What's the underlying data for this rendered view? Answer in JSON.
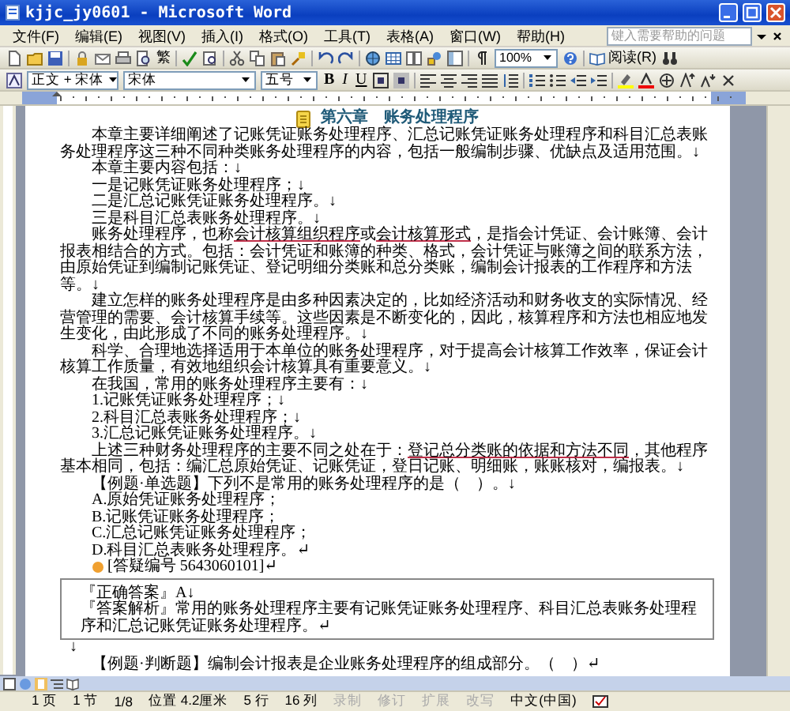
{
  "window": {
    "title": "kjjc_jy0601 - Microsoft Word"
  },
  "menu": {
    "items": [
      "文件(F)",
      "编辑(E)",
      "视图(V)",
      "插入(I)",
      "格式(O)",
      "工具(T)",
      "表格(A)",
      "窗口(W)",
      "帮助(H)"
    ],
    "help_placeholder": "键入需要帮助的问题"
  },
  "standard_toolbar": {
    "traditional_label": "繁",
    "zoom": "100%",
    "read_button": "阅读(R)"
  },
  "format_toolbar": {
    "style": "正文 + 宋体",
    "font": "宋体",
    "size": "五号",
    "buttons": [
      "B",
      "I",
      "U"
    ]
  },
  "document": {
    "blocks": [
      {
        "kind": "heading",
        "text": "第六章　账务处理程序"
      },
      {
        "kind": "paragraph",
        "text": "本章主要详细阐述了记账凭证账务处理程序、汇总记账凭证账务处理程序和科目汇总表账务处理程序这三种不同种类账务处理程序的内容，包括一般编制步骤、优缺点及适用范围。↓"
      },
      {
        "kind": "paragraph",
        "text": "本章主要内容包括：↓"
      },
      {
        "kind": "paragraph",
        "text": "一是记账凭证账务处理程序；↓"
      },
      {
        "kind": "paragraph",
        "text": "二是汇总记账凭证账务处理程序。↓"
      },
      {
        "kind": "paragraph",
        "text": "三是科目汇总表账务处理程序。↓"
      },
      {
        "kind": "paragraph",
        "segments": [
          {
            "text": "账务处理程序，也称",
            "link": false
          },
          {
            "text": "会计核算组织程序",
            "link": true
          },
          {
            "text": "或",
            "link": false
          },
          {
            "text": "会计核算形式",
            "link": true
          },
          {
            "text": "，是指会计凭证、会计账簿、会计报表相结合的方式。包括：会计凭证和账簿的种类、格式，会计凭证与账簿之间的联系方法，由原始凭证到编制记账凭证、登记明细分类账和总分类账，编制会计报表的工作程序和方法等。↓",
            "link": false
          }
        ]
      },
      {
        "kind": "paragraph",
        "text": "建立怎样的账务处理程序是由多种因素决定的，比如经济活动和财务收支的实际情况、经营管理的需要、会计核算手续等。这些因素是不断变化的，因此，核算程序和方法也相应地发生变化，由此形成了不同的账务处理程序。↓"
      },
      {
        "kind": "paragraph",
        "text": "科学、合理地选择适用于本单位的账务处理程序，对于提高会计核算工作效率，保证会计核算工作质量，有效地组织会计核算具有重要意义。↓"
      },
      {
        "kind": "paragraph",
        "text": "在我国，常用的账务处理程序主要有：↓"
      },
      {
        "kind": "paragraph",
        "text": "1.记账凭证账务处理程序；↓"
      },
      {
        "kind": "paragraph",
        "text": "2.科目汇总表账务处理程序；↓"
      },
      {
        "kind": "paragraph",
        "text": "3.汇总记账凭证账务处理程序。↓"
      },
      {
        "kind": "paragraph",
        "segments": [
          {
            "text": "上述三种财务处理程序的主要不同之处在于：",
            "link": false
          },
          {
            "text": "登记总分类账的依据和方法不同",
            "link": true
          },
          {
            "text": "，其他程序基本相同，包括：编汇总原始凭证、记账凭证，登日记账、明细账，账账核对，编报表。↓",
            "link": false
          }
        ]
      },
      {
        "kind": "paragraph",
        "text": "【例题·单选题】下列不是常用的账务处理程序的是（　）。↓"
      },
      {
        "kind": "paragraph",
        "text": "A.原始凭证账务处理程序；"
      },
      {
        "kind": "paragraph",
        "text": "B.记账凭证账务处理程序；"
      },
      {
        "kind": "paragraph",
        "text": "C.汇总记账凭证账务处理程序；"
      },
      {
        "kind": "paragraph",
        "text": "D.科目汇总表账务处理程序。↵"
      },
      {
        "kind": "reference",
        "text": "[答疑编号 5643060101]↵"
      },
      {
        "kind": "answer_box",
        "lines": [
          "『正确答案』A↓",
          "『答案解析』常用的账务处理程序主要有记账凭证账务处理程序、科目汇总表账务处理程序和汇总记账凭证账务处理程序。↵"
        ]
      },
      {
        "kind": "mark",
        "text": "↓"
      },
      {
        "kind": "paragraph",
        "text": "【例题·判断题】编制会计报表是企业账务处理程序的组成部分。（　）↵"
      }
    ]
  },
  "status_bar": {
    "items": [
      {
        "text": "1 页",
        "disabled": false
      },
      {
        "text": "1 节",
        "disabled": false
      },
      {
        "text": "1/8",
        "disabled": false
      },
      {
        "text": "位置 4.2厘米",
        "disabled": false
      },
      {
        "text": "5 行",
        "disabled": false
      },
      {
        "text": "16 列",
        "disabled": false
      },
      {
        "text": "录制",
        "disabled": true
      },
      {
        "text": "修订",
        "disabled": true
      },
      {
        "text": "扩展",
        "disabled": true
      },
      {
        "text": "改写",
        "disabled": true
      },
      {
        "text": "中文(中国)",
        "disabled": false
      }
    ]
  }
}
